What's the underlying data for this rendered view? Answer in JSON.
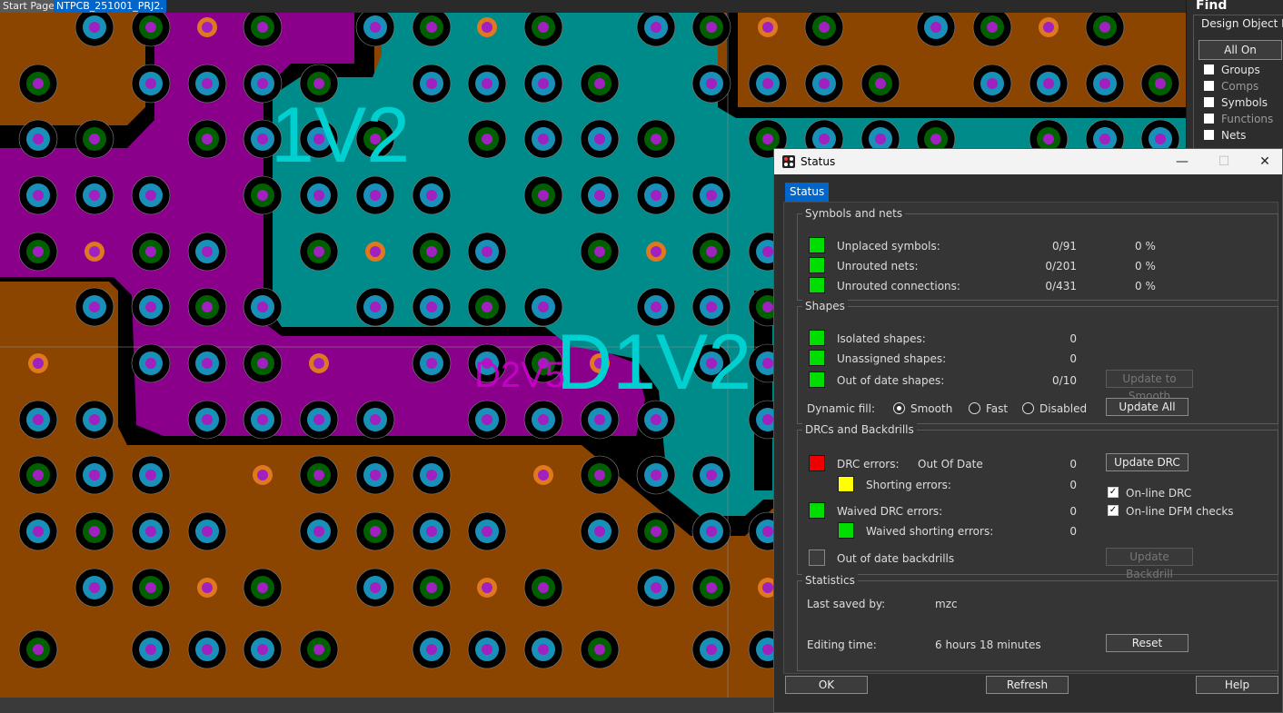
{
  "tabs": {
    "start_page": "Start Page",
    "project": "NTPCB_251001_PRJ2."
  },
  "canvas_labels": {
    "a": "1V2",
    "b": "D1V2",
    "c": "D2V5"
  },
  "find_panel": {
    "title": "Find",
    "group_label": "Design Object Find",
    "all_on": "All On",
    "items": [
      {
        "label": "Groups",
        "enabled": true
      },
      {
        "label": "Comps",
        "enabled": false
      },
      {
        "label": "Symbols",
        "enabled": true
      },
      {
        "label": "Functions",
        "enabled": false
      },
      {
        "label": "Nets",
        "enabled": true
      }
    ]
  },
  "dialog": {
    "title": "Status",
    "tab": "Status",
    "symbols_nets": {
      "label": "Symbols and nets",
      "rows": [
        {
          "label": "Unplaced symbols:",
          "value": "0/91",
          "pct": "0 %",
          "status": "green"
        },
        {
          "label": "Unrouted nets:",
          "value": "0/201",
          "pct": "0 %",
          "status": "green"
        },
        {
          "label": "Unrouted connections:",
          "value": "0/431",
          "pct": "0 %",
          "status": "green"
        }
      ]
    },
    "shapes": {
      "label": "Shapes",
      "rows": [
        {
          "label": "Isolated shapes:",
          "value": "0",
          "status": "green"
        },
        {
          "label": "Unassigned shapes:",
          "value": "0",
          "status": "green"
        },
        {
          "label": "Out of date shapes:",
          "value": "0/10",
          "status": "green"
        }
      ],
      "update_smooth": "Update to Smooth",
      "dynamic_fill_label": "Dynamic fill:",
      "fill_options": [
        "Smooth",
        "Fast",
        "Disabled"
      ],
      "fill_selected": "Smooth",
      "update_all": "Update All"
    },
    "drc": {
      "label": "DRCs and Backdrills",
      "drc_errors": {
        "label": "DRC errors:",
        "state": "Out Of Date",
        "value": "0",
        "status": "red"
      },
      "shorting": {
        "label": "Shorting errors:",
        "value": "0",
        "status": "yellow"
      },
      "waived": {
        "label": "Waived DRC errors:",
        "value": "0",
        "status": "green"
      },
      "waived_short": {
        "label": "Waived shorting errors:",
        "value": "0",
        "status": "green"
      },
      "backdrills": {
        "label": "Out of date backdrills",
        "status": "gray"
      },
      "update_drc": "Update DRC",
      "online_drc": "On-line DRC",
      "online_dfm": "On-line DFM checks",
      "update_backdrill": "Update Backdrill"
    },
    "statistics": {
      "label": "Statistics",
      "last_saved_label": "Last saved by:",
      "last_saved_value": "mzc",
      "editing_time_label": "Editing time:",
      "editing_time_value": "6 hours 18 minutes",
      "reset": "Reset"
    },
    "buttons": {
      "ok": "OK",
      "refresh": "Refresh",
      "help": "Help"
    }
  },
  "colors": {
    "board": "#8b4500",
    "plane_cyan": "#008b8b",
    "plane_magenta": "#8b008b",
    "gap": "#000000",
    "green_status": "#00dd00",
    "red_status": "#ee0000",
    "tab_blue": "#0066cc"
  }
}
